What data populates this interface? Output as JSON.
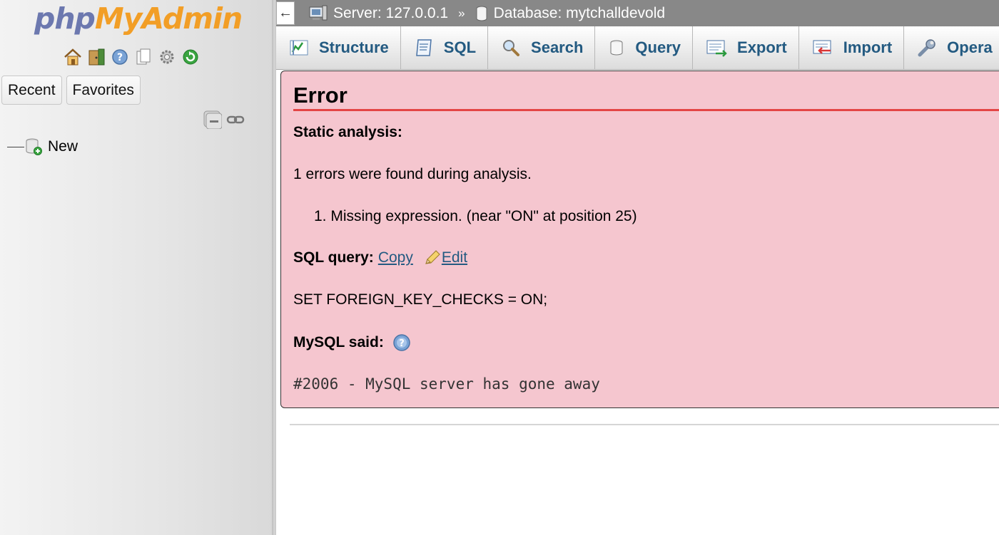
{
  "nav": {
    "logo": {
      "php": "php",
      "my": "My",
      "admin": "Admin"
    },
    "icons": [
      "home-icon",
      "exit-icon",
      "help-icon",
      "docs-icon",
      "settings-icon",
      "reload-icon"
    ],
    "tabs": {
      "recent": "Recent",
      "favorites": "Favorites"
    },
    "tree_new_label": "New"
  },
  "breadcrumb": {
    "back": "←",
    "server": "Server: 127.0.0.1",
    "separator": "»",
    "database": "Database: mytchalldevold"
  },
  "tabs": [
    {
      "label": "Structure",
      "icon": "structure-icon"
    },
    {
      "label": "SQL",
      "icon": "sql-icon"
    },
    {
      "label": "Search",
      "icon": "search-icon"
    },
    {
      "label": "Query",
      "icon": "query-icon"
    },
    {
      "label": "Export",
      "icon": "export-icon"
    },
    {
      "label": "Import",
      "icon": "import-icon"
    },
    {
      "label": "Opera",
      "icon": "operations-icon"
    }
  ],
  "error": {
    "title": "Error",
    "static_analysis_label": "Static analysis:",
    "summary": "1 errors were found during analysis.",
    "items": [
      "1. Missing expression. (near \"ON\" at position 25)"
    ],
    "sql_query_label": "SQL query:",
    "copy_link": "Copy",
    "edit_link": "Edit",
    "query": "SET FOREIGN_KEY_CHECKS = ON;",
    "mysql_said_label": "MySQL said:",
    "mysql_message": "#2006 - MySQL server has gone away"
  },
  "colors": {
    "link": "#235a81",
    "error_bg": "#f5c6cf",
    "error_rule": "#e34545",
    "topbar": "#888888"
  }
}
